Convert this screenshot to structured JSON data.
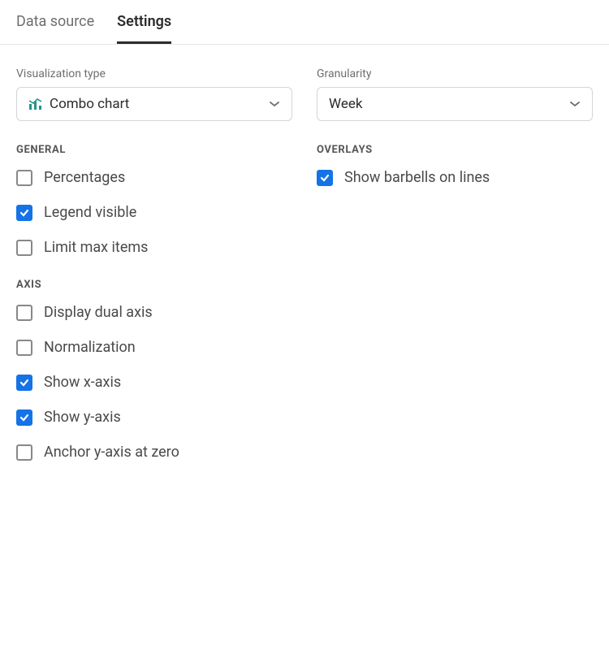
{
  "tabs": [
    {
      "label": "Data source",
      "active": false
    },
    {
      "label": "Settings",
      "active": true
    }
  ],
  "left": {
    "vizType": {
      "label": "Visualization type",
      "value": "Combo chart"
    },
    "generalHeading": "GENERAL",
    "general": [
      {
        "label": "Percentages",
        "checked": false
      },
      {
        "label": "Legend visible",
        "checked": true
      },
      {
        "label": "Limit max items",
        "checked": false
      }
    ],
    "axisHeading": "AXIS",
    "axis": [
      {
        "label": "Display dual axis",
        "checked": false
      },
      {
        "label": "Normalization",
        "checked": false
      },
      {
        "label": "Show x-axis",
        "checked": true
      },
      {
        "label": "Show y-axis",
        "checked": true
      },
      {
        "label": "Anchor y-axis at zero",
        "checked": false
      }
    ]
  },
  "right": {
    "granularity": {
      "label": "Granularity",
      "value": "Week"
    },
    "overlaysHeading": "OVERLAYS",
    "overlays": [
      {
        "label": "Show barbells on lines",
        "checked": true
      }
    ]
  }
}
